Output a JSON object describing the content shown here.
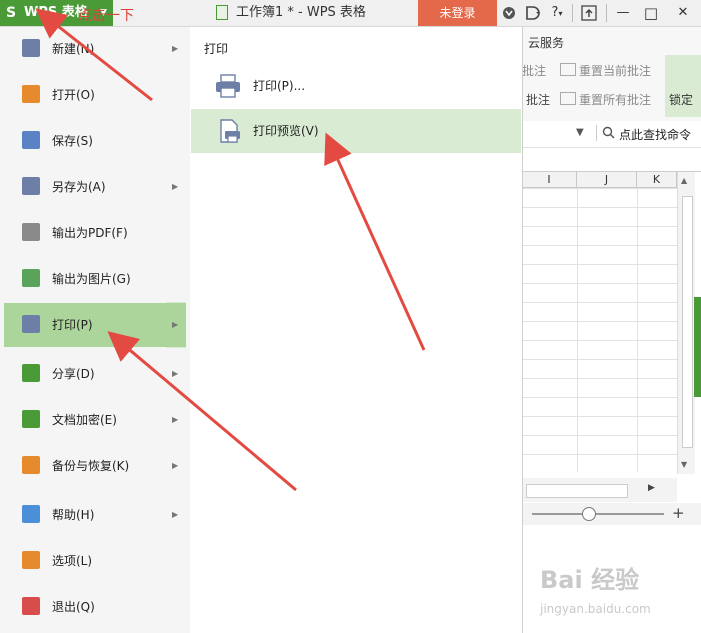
{
  "app": {
    "button_label": "WPS 表格",
    "logo_glyph": "S",
    "window_title": "工作簿1 * - WPS 表格",
    "login_label": "未登录",
    "accent_color": "#4a9a37"
  },
  "titlebar_icons": [
    "skin-icon",
    "doc-share-icon",
    "help-icon",
    "upload-icon",
    "minimize-icon",
    "maximize-icon",
    "close-icon"
  ],
  "titlebar_glyphs": {
    "help": "?",
    "minimize": "—",
    "maximize": "□",
    "close": "✕"
  },
  "ribbon": {
    "tab_label": "云服务",
    "items": [
      "批注",
      "重置当前批注",
      "批注",
      "重置所有批注"
    ],
    "right_label": "锁定"
  },
  "search": {
    "placeholder": "点此查找命令"
  },
  "columns": [
    "I",
    "J",
    "K"
  ],
  "annotation_text": "点击一下",
  "menu": {
    "items": [
      {
        "label": "新建(N)",
        "icon": "new-file-icon",
        "arrow": "▶"
      },
      {
        "label": "打开(O)",
        "icon": "open-folder-icon",
        "arrow": ""
      },
      {
        "label": "保存(S)",
        "icon": "save-icon",
        "arrow": ""
      },
      {
        "label": "另存为(A)",
        "icon": "save-as-icon",
        "arrow": "▶"
      },
      {
        "label": "输出为PDF(F)",
        "icon": "pdf-icon",
        "arrow": ""
      },
      {
        "label": "输出为图片(G)",
        "icon": "image-export-icon",
        "arrow": ""
      },
      {
        "label": "打印(P)",
        "icon": "print-icon",
        "arrow": "▶"
      },
      {
        "label": "分享(D)",
        "icon": "share-icon",
        "arrow": "▶"
      },
      {
        "label": "文档加密(E)",
        "icon": "encrypt-icon",
        "arrow": "▶"
      },
      {
        "label": "备份与恢复(K)",
        "icon": "backup-icon",
        "arrow": "▶"
      },
      {
        "label": "帮助(H)",
        "icon": "help-circle-icon",
        "arrow": "▶"
      },
      {
        "label": "选项(L)",
        "icon": "options-gear-icon",
        "arrow": ""
      },
      {
        "label": "退出(Q)",
        "icon": "exit-icon",
        "arrow": ""
      }
    ]
  },
  "submenu": {
    "title": "打印",
    "items": [
      {
        "label": "打印(P)...",
        "icon": "printer-icon"
      },
      {
        "label": "打印预览(V)",
        "icon": "print-preview-icon"
      }
    ]
  },
  "watermark": {
    "brand": "Bai 经验",
    "url": "jingyan.baidu.com"
  }
}
